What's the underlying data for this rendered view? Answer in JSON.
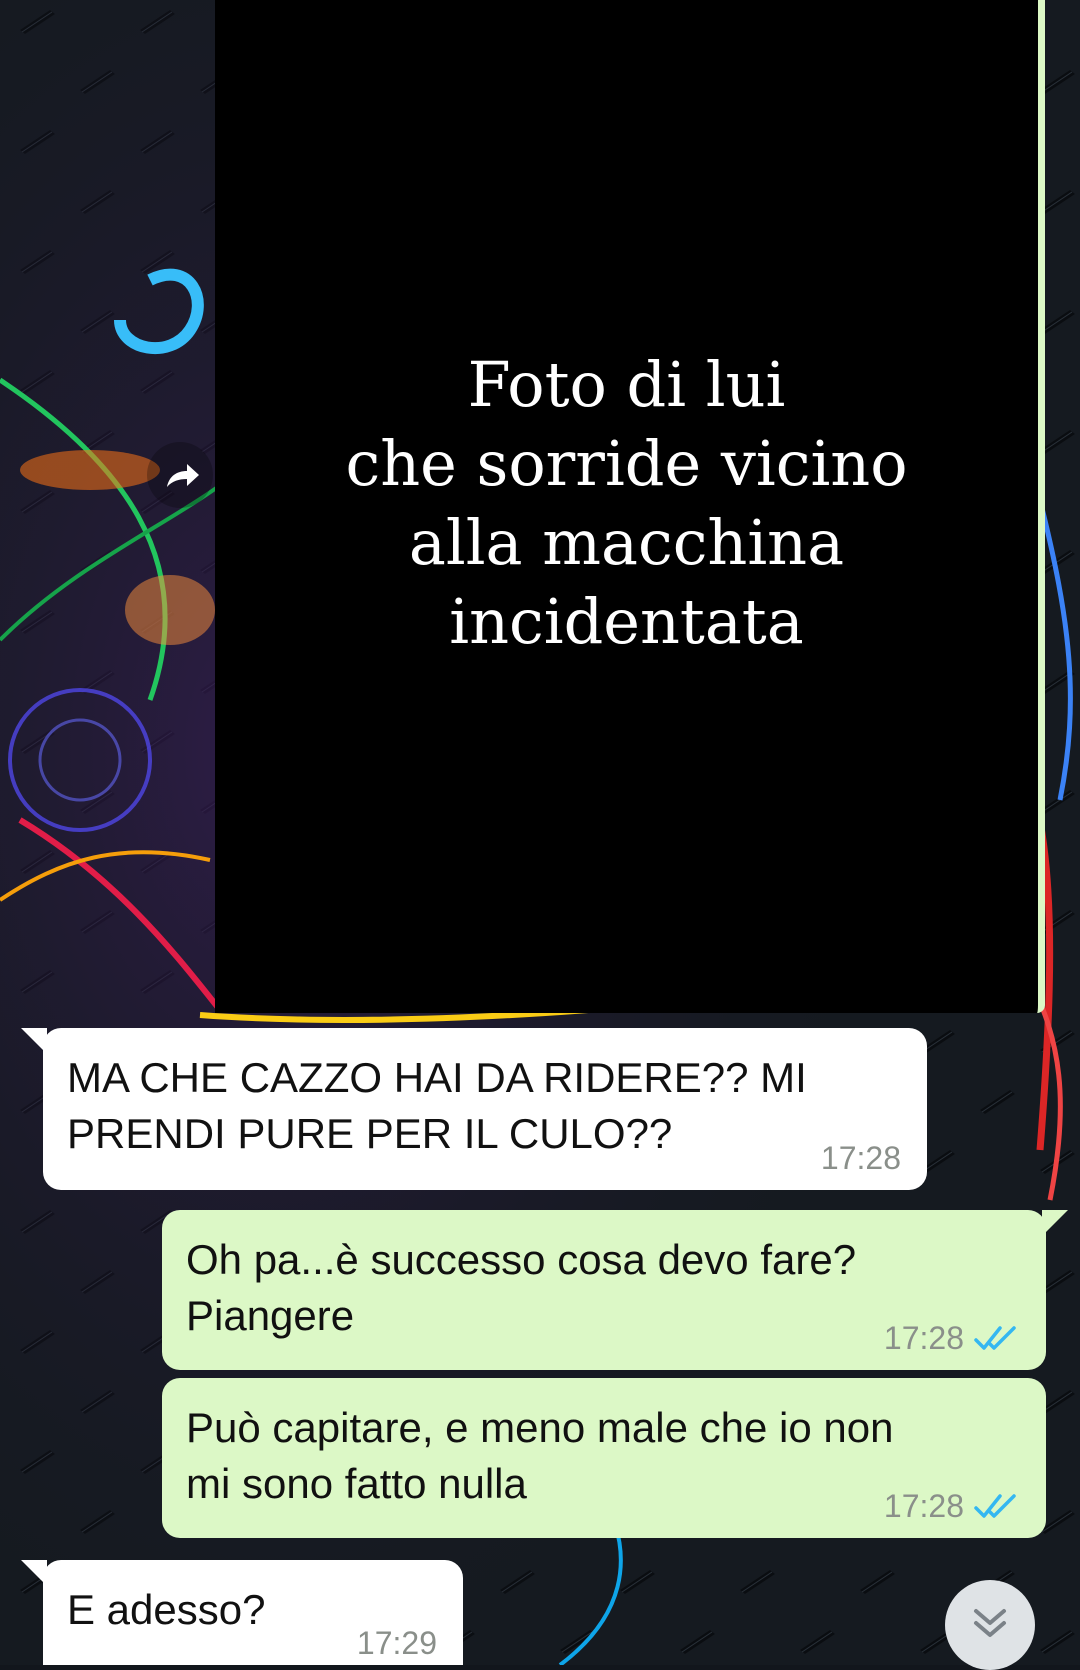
{
  "wallpaper": {
    "description_icon": "dark-diamond-plate-with-neon-pattern"
  },
  "image_message": {
    "caption": "Foto di lui\nche sorride vicino\nalla macchina\nincidentata",
    "forward_icon": "forward-arrow-icon"
  },
  "messages": [
    {
      "direction": "in",
      "text": "MA CHE CAZZO HAI DA RIDERE?? MI\nPRENDI PURE PER IL CULO??",
      "time": "17:28"
    },
    {
      "direction": "out",
      "text": "Oh pa...è successo cosa devo fare?\nPiangere",
      "time": "17:28",
      "status": "read"
    },
    {
      "direction": "out",
      "text": "Può capitare, e meno male che io non\nmi sono fatto nulla",
      "time": "17:28",
      "status": "read"
    },
    {
      "direction": "in",
      "text": "E adesso?",
      "time": "17:29"
    }
  ],
  "scroll_button": {
    "icon": "double-chevron-down-icon"
  },
  "colors": {
    "incoming_bubble": "#ffffff",
    "outgoing_bubble": "#dcf8c6",
    "read_ticks": "#34b7f1",
    "timestamp": "#8a8f8a"
  }
}
